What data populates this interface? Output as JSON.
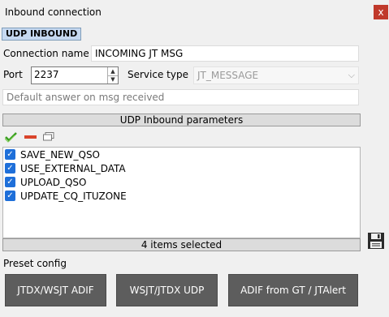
{
  "window": {
    "title": "Inbound connection",
    "close_label": "x"
  },
  "section": {
    "label": "UDP INBOUND"
  },
  "connection_name": {
    "label": "Connection name",
    "value": "INCOMING JT MSG"
  },
  "port": {
    "label": "Port",
    "value": "2237"
  },
  "service_type": {
    "label": "Service type",
    "value": "JT_MESSAGE"
  },
  "default_answer": {
    "placeholder": "Default answer on msg received"
  },
  "parameters": {
    "header": "UDP Inbound parameters",
    "items": [
      {
        "label": "SAVE_NEW_QSO",
        "checked": true
      },
      {
        "label": "USE_EXTERNAL_DATA",
        "checked": true
      },
      {
        "label": "UPLOAD_QSO",
        "checked": true
      },
      {
        "label": "UPDATE_CQ_ITUZONE",
        "checked": true
      }
    ],
    "status": "4 items selected"
  },
  "icons": {
    "check_all": "checkmark-icon",
    "remove": "remove-icon",
    "window": "window-icon",
    "save": "floppy-disk-icon",
    "close": "close-icon"
  },
  "preset": {
    "label": "Preset config",
    "buttons": [
      "JTDX/WSJT ADIF",
      "WSJT/JTDX UDP",
      "ADIF from GT / JTAlert"
    ]
  },
  "colors": {
    "section_badge": "#c6d9f1",
    "checkbox": "#1e6fd9",
    "preset_button": "#5d5d5d",
    "close": "#c0392b"
  }
}
